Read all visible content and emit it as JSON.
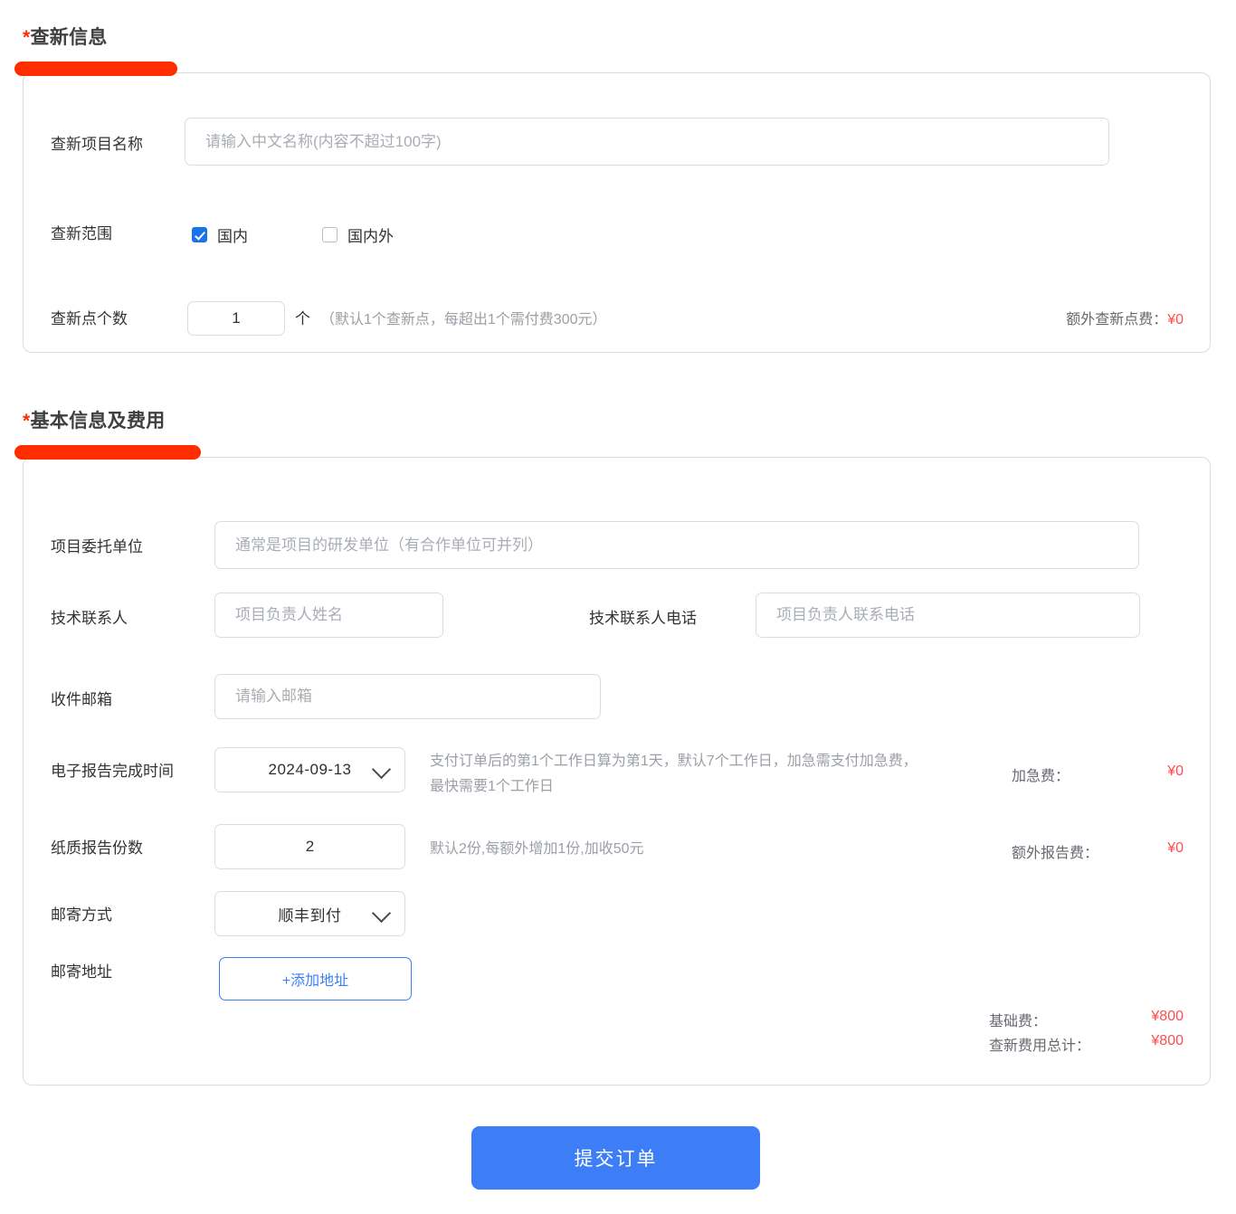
{
  "sections": [
    {
      "id": "search-info",
      "required_mark": "*",
      "title": "查新信息",
      "fields": {
        "project_name": {
          "label": "查新项目名称",
          "value": "",
          "placeholder": "请输入中文名称(内容不超过100字)"
        },
        "search_scope": {
          "label": "查新范围",
          "options": [
            {
              "label": "国内",
              "checked": true
            },
            {
              "label": "国内外",
              "checked": false
            }
          ]
        },
        "search_points": {
          "label": "查新点个数",
          "value": "1",
          "unit": "个",
          "hint": "（默认1个查新点，每超出1个需付费300元）"
        }
      },
      "fees": [
        {
          "name": "额外查新点费：",
          "value": "¥0"
        }
      ]
    },
    {
      "id": "basic-info-fee",
      "required_mark": "*",
      "title": "基本信息及费用",
      "fields": {
        "client_unit": {
          "label": "项目委托单位",
          "value": "",
          "placeholder": "通常是项目的研发单位（有合作单位可并列）"
        },
        "tech_contact": {
          "label": "技术联系人",
          "value": "",
          "placeholder": "项目负责人姓名"
        },
        "tech_contact_phone": {
          "label": "技术联系人电话",
          "value": "",
          "placeholder": "项目负责人联系电话"
        },
        "email": {
          "label": "收件邮箱",
          "value": "",
          "placeholder": "请输入邮箱"
        },
        "report_date": {
          "label": "电子报告完成时间",
          "value": "2024-09-13",
          "icon": "chevron-down-icon",
          "hint_line1": "支付订单后的第1个工作日算为第1天，默认7个工作日，加急需支付加急费，",
          "hint_line2": "最快需要1个工作日"
        },
        "paper_report_count": {
          "label": "纸质报告份数",
          "value": "2",
          "hint": "默认2份,每额外增加1份,加收50元"
        },
        "mail_method": {
          "label": "邮寄方式",
          "value": "顺丰到付",
          "icon": "chevron-down-icon"
        },
        "mail_address": {
          "label": "邮寄地址",
          "add_button_label": "+添加地址"
        }
      },
      "fees": [
        {
          "name": "加急费：",
          "value": "¥0"
        },
        {
          "name": "额外报告费：",
          "value": "¥0"
        },
        {
          "name": "基础费：",
          "value": "¥800"
        },
        {
          "name": "查新费用总计：",
          "value": "¥800"
        }
      ]
    }
  ],
  "submit": {
    "label": "提交订单"
  },
  "colors": {
    "accent_red": "#ff2d00",
    "fee_red": "#ff4d4f",
    "primary_blue": "#3d7ef7",
    "checkbox_blue": "#1a73e8",
    "border_gray": "#dcdcdc"
  }
}
